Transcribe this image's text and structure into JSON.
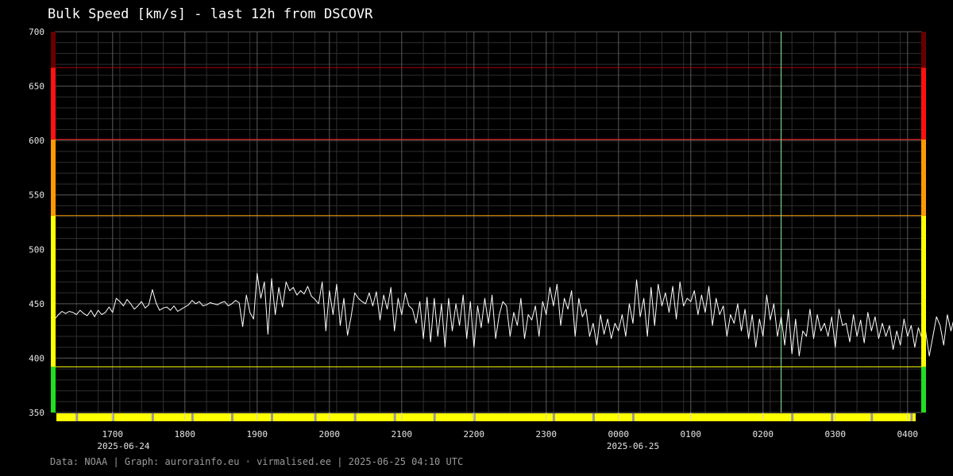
{
  "title": "Bulk Speed [km/s] - last 12h from DSCOVR",
  "footer": "Data: NOAA | Graph: aurorainfo.eu · virmalised.ee | 2025-06-25 04:10 UTC",
  "colors": {
    "background": "#000000",
    "grid_major": "#5a5a5a",
    "grid_minor": "#2e2e2e",
    "series": "#ffffff",
    "now_marker": "#90ee90",
    "status_bar": "#ffff00",
    "status_gap": "#9a9a9a",
    "band_green": "#22dd22",
    "band_yellow": "#ffff00",
    "band_orange": "#ff9900",
    "band_red": "#ff1111",
    "band_darkred": "#660000"
  },
  "chart_data": {
    "type": "line",
    "title": "Bulk Speed [km/s] - last 12h from DSCOVR",
    "ylabel": "",
    "xlabel": "",
    "ylim": [
      350,
      700
    ],
    "xlim_hours": [
      16.2,
      28.2
    ],
    "y_ticks": [
      350,
      400,
      450,
      500,
      550,
      600,
      650,
      700
    ],
    "x_ticks": [
      {
        "hour": 17,
        "label": "1700"
      },
      {
        "hour": 18,
        "label": "1800"
      },
      {
        "hour": 19,
        "label": "1900"
      },
      {
        "hour": 20,
        "label": "2000"
      },
      {
        "hour": 21,
        "label": "2100"
      },
      {
        "hour": 22,
        "label": "2200"
      },
      {
        "hour": 23,
        "label": "2300"
      },
      {
        "hour": 24,
        "label": "0000"
      },
      {
        "hour": 25,
        "label": "0100"
      },
      {
        "hour": 26,
        "label": "0200"
      },
      {
        "hour": 27,
        "label": "0300"
      },
      {
        "hour": 28,
        "label": "0400"
      }
    ],
    "date_labels": [
      {
        "hour": 17.15,
        "label": "2025-06-24"
      },
      {
        "hour": 24.2,
        "label": "2025-06-25"
      }
    ],
    "thresholds": [
      {
        "value": 392,
        "color": "#ffff00"
      },
      {
        "value": 531,
        "color": "#ff9900"
      },
      {
        "value": 601,
        "color": "#ff2222"
      },
      {
        "value": 667,
        "color": "#aa0000"
      }
    ],
    "bands": [
      {
        "from": 350,
        "to": 392,
        "color": "#22dd22"
      },
      {
        "from": 392,
        "to": 531,
        "color": "#ffff00"
      },
      {
        "from": 531,
        "to": 601,
        "color": "#ff9900"
      },
      {
        "from": 601,
        "to": 667,
        "color": "#ff1111"
      },
      {
        "from": 667,
        "to": 700,
        "color": "#660000"
      }
    ],
    "now_hour": 26.25,
    "grid": true,
    "status_gaps_hours": [
      16.5,
      17.0,
      17.55,
      18.1,
      18.65,
      19.2,
      19.8,
      20.35,
      20.9,
      21.45,
      22.0,
      23.1,
      23.65,
      24.2,
      26.4,
      26.95,
      27.5,
      28.05
    ],
    "series": [
      {
        "name": "",
        "x_start_hour": 16.2,
        "x_step_hours": 0.05,
        "values": [
          436,
          440,
          443,
          441,
          443,
          442,
          440,
          444,
          441,
          439,
          444,
          438,
          444,
          440,
          442,
          447,
          442,
          455,
          452,
          448,
          454,
          450,
          445,
          448,
          452,
          446,
          449,
          463,
          451,
          444,
          446,
          447,
          444,
          448,
          443,
          445,
          447,
          449,
          453,
          450,
          452,
          448,
          449,
          451,
          450,
          449,
          451,
          452,
          448,
          450,
          453,
          451,
          429,
          458,
          442,
          436,
          478,
          455,
          470,
          422,
          473,
          440,
          465,
          447,
          470,
          462,
          465,
          458,
          462,
          459,
          466,
          457,
          454,
          450,
          470,
          425,
          462,
          440,
          468,
          430,
          455,
          421,
          438,
          460,
          455,
          452,
          450,
          460,
          448,
          461,
          435,
          458,
          445,
          465,
          425,
          455,
          440,
          460,
          448,
          445,
          432,
          452,
          418,
          456,
          415,
          455,
          420,
          450,
          410,
          455,
          425,
          450,
          430,
          458,
          418,
          452,
          410,
          448,
          428,
          455,
          432,
          458,
          418,
          440,
          452,
          448,
          420,
          442,
          430,
          455,
          418,
          440,
          435,
          448,
          420,
          452,
          440,
          465,
          448,
          468,
          430,
          455,
          445,
          462,
          420,
          455,
          438,
          445,
          420,
          432,
          412,
          440,
          422,
          436,
          418,
          432,
          425,
          440,
          420,
          450,
          432,
          472,
          438,
          455,
          420,
          465,
          430,
          468,
          448,
          460,
          442,
          466,
          436,
          470,
          448,
          455,
          452,
          462,
          440,
          458,
          442,
          466,
          430,
          455,
          440,
          448,
          420,
          440,
          432,
          450,
          425,
          445,
          418,
          440,
          410,
          436,
          420,
          458,
          435,
          450,
          420,
          438,
          412,
          445,
          404,
          436,
          402,
          425,
          420,
          445,
          418,
          440,
          425,
          432,
          420,
          438,
          410,
          445,
          430,
          432,
          415,
          440,
          420,
          435,
          414,
          442,
          425,
          438,
          418,
          432,
          420,
          430,
          408,
          425,
          412,
          436,
          420,
          430,
          410,
          428,
          418,
          425,
          402,
          420,
          438,
          430,
          412,
          440,
          425,
          438,
          408,
          432,
          415,
          438,
          412,
          425
        ]
      }
    ]
  }
}
